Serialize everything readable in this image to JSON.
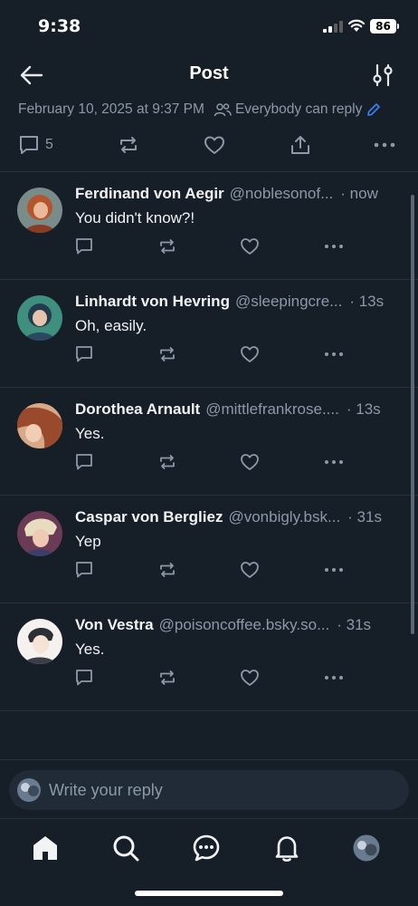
{
  "status_bar": {
    "time": "9:38",
    "battery": "86"
  },
  "header": {
    "title": "Post"
  },
  "post_meta": {
    "date": "February 10, 2025 at 9:37 PM",
    "reply_setting": "Everybody can reply"
  },
  "post_actions": {
    "reply_count": "5"
  },
  "replies": [
    {
      "name": "Ferdinand von Aegir",
      "handle": "@noblesonof...",
      "time": "· now",
      "text": "You didn't know?!"
    },
    {
      "name": "Linhardt von Hevring",
      "handle": "@sleepingcre...",
      "time": "· 13s",
      "text": "Oh, easily."
    },
    {
      "name": "Dorothea Arnault",
      "handle": "@mittlefrankrose....",
      "time": "· 13s",
      "text": "Yes."
    },
    {
      "name": "Caspar von Bergliez",
      "handle": "@vonbigly.bsk...",
      "time": "· 31s",
      "text": "Yep"
    },
    {
      "name": "Von Vestra",
      "handle": "@poisoncoffee.bsky.so...",
      "time": "· 31s",
      "text": "Yes."
    }
  ],
  "composer": {
    "placeholder": "Write your reply"
  },
  "colors": {
    "background": "#161e27",
    "muted": "#8c99a8",
    "accent": "#3b82f6",
    "divider": "#27323f"
  },
  "icons": [
    "back-arrow-icon",
    "filter-icon",
    "people-icon",
    "pencil-icon",
    "reply-icon",
    "repost-icon",
    "like-icon",
    "share-icon",
    "more-icon",
    "home-icon",
    "search-icon",
    "chat-icon",
    "bell-icon"
  ]
}
